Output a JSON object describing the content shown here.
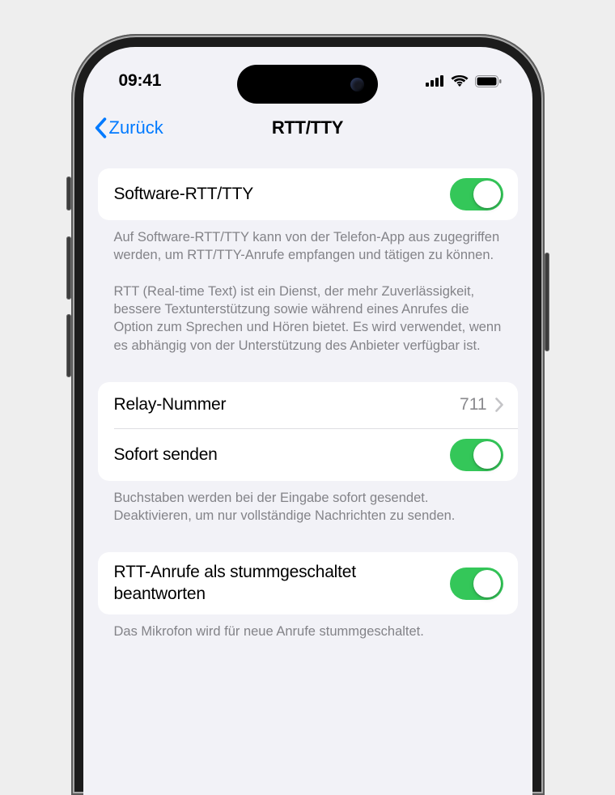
{
  "status": {
    "time": "09:41"
  },
  "nav": {
    "back_label": "Zurück",
    "title": "RTT/TTY"
  },
  "group1": {
    "software_label": "Software-RTT/TTY",
    "software_on": true,
    "footer": "Auf Software-RTT/TTY kann von der Telefon-App aus zugegriffen werden, um RTT/TTY-Anrufe empfangen und tätigen zu können.\n\nRTT (Real-time Text) ist ein Dienst, der mehr Zuverlässigkeit, bessere Textunterstützung sowie während eines Anrufes die Option zum Sprechen und Hören bietet. Es wird verwendet, wenn es abhängig von der Unterstützung des Anbieter verfügbar ist."
  },
  "group2": {
    "relay_label": "Relay-Nummer",
    "relay_value": "711",
    "send_label": "Sofort senden",
    "send_on": true,
    "footer": "Buchstaben werden bei der Eingabe sofort gesendet. Deaktivieren, um nur vollständige Nachrichten zu senden."
  },
  "group3": {
    "mute_label": "RTT-Anrufe als stummgeschaltet beantworten",
    "mute_on": true,
    "footer": "Das Mikrofon wird für neue Anrufe stummgeschaltet."
  }
}
